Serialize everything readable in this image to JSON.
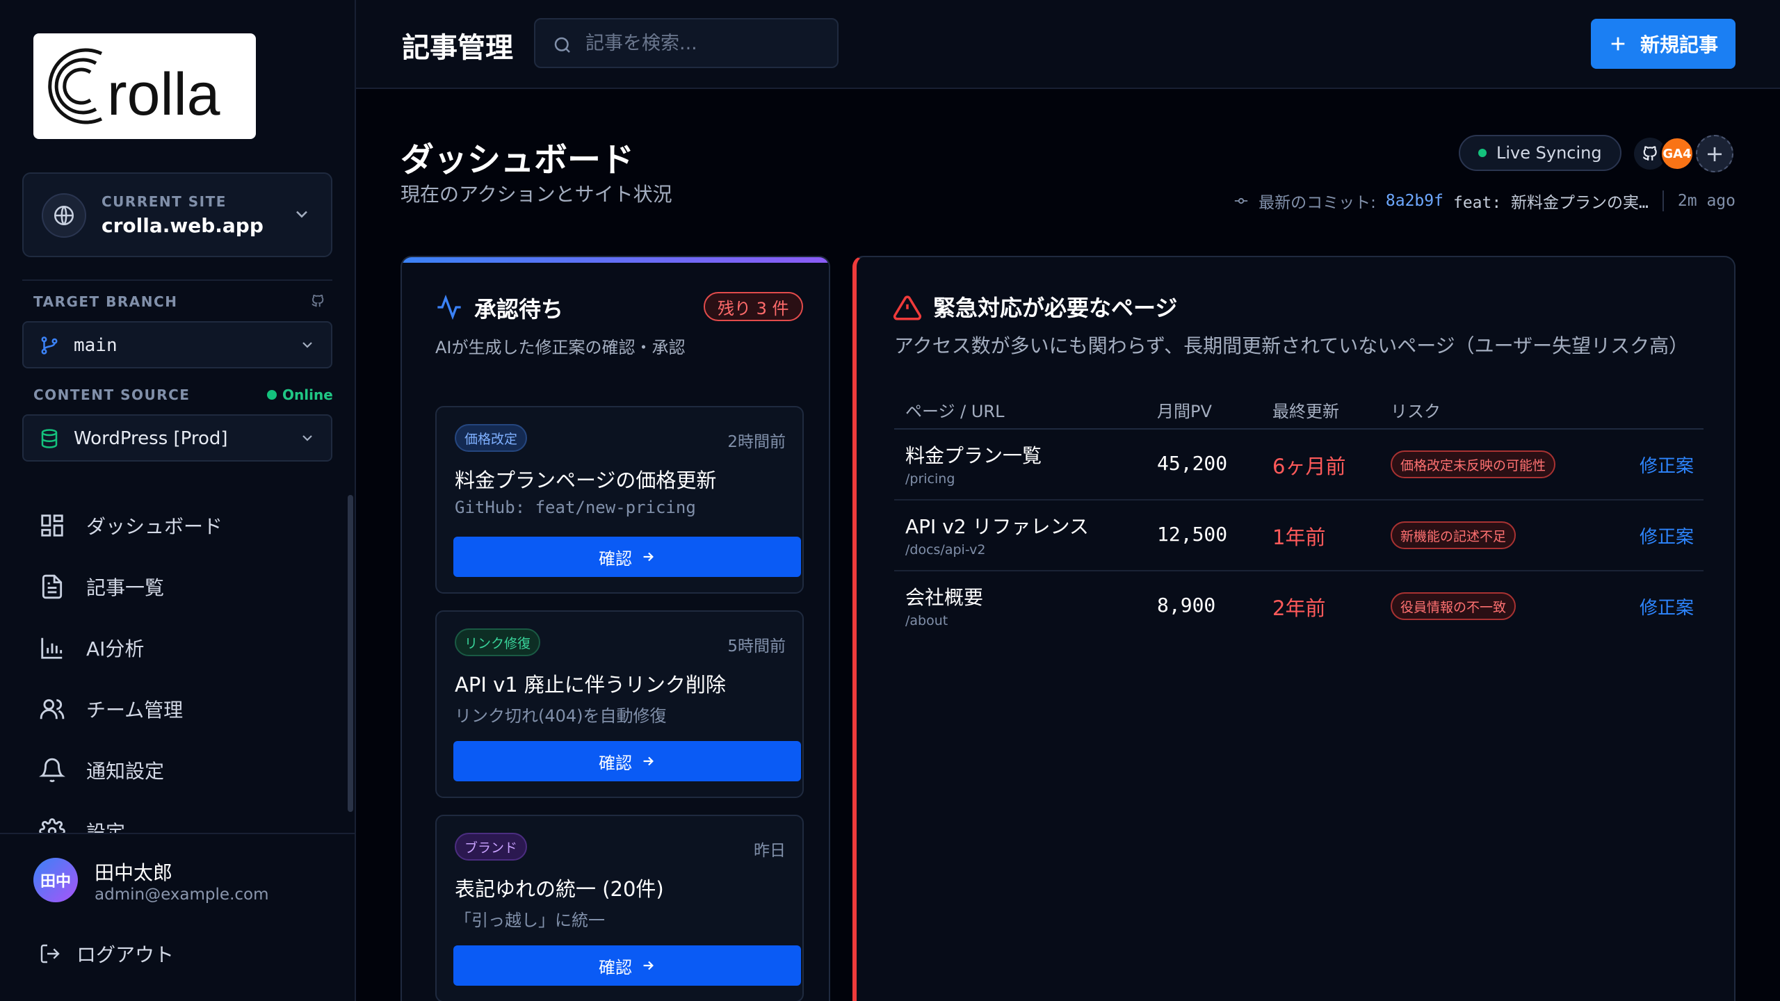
{
  "brand": {
    "logo_text": "Crolla"
  },
  "sidebar": {
    "site_caption": "CURRENT SITE",
    "site_name": "crolla.web.app",
    "branch_caption": "TARGET BRANCH",
    "branch": "main",
    "source_caption": "CONTENT SOURCE",
    "source_status": "Online",
    "source": "WordPress [Prod]",
    "nav": [
      {
        "label": "ダッシュボード",
        "icon": "grid-icon"
      },
      {
        "label": "記事一覧",
        "icon": "document-icon"
      },
      {
        "label": "AI分析",
        "icon": "bar-chart-icon"
      },
      {
        "label": "チーム管理",
        "icon": "users-icon"
      },
      {
        "label": "通知設定",
        "icon": "bell-icon"
      },
      {
        "label": "設定",
        "icon": "gear-icon"
      }
    ],
    "user": {
      "initials": "田中",
      "name": "田中太郎",
      "email": "admin@example.com"
    },
    "logout": "ログアウト"
  },
  "header": {
    "title": "記事管理",
    "search_placeholder": "記事を検索...",
    "new_button": "新規記事"
  },
  "dashboard": {
    "title": "ダッシュボード",
    "subtitle": "現在のアクションとサイト状況",
    "live_status": "Live Syncing",
    "integrations": [
      "GA4"
    ],
    "commit_label": "最新のコミット:",
    "commit_hash": "8a2b9f",
    "commit_message": "feat: 新料金プランの実…",
    "commit_time": "2m ago"
  },
  "pending": {
    "title": "承認待ち",
    "badge": "残り 3 件",
    "subtitle": "AIが生成した修正案の確認・承認",
    "confirm_label": "確認",
    "tasks": [
      {
        "tag": "価格改定",
        "time": "2時間前",
        "title": "料金プランページの価格更新",
        "desc": "GitHub: feat/new-pricing"
      },
      {
        "tag": "リンク修復",
        "time": "5時間前",
        "title": "API v1 廃止に伴うリンク削除",
        "desc": "リンク切れ(404)を自動修復"
      },
      {
        "tag": "ブランド",
        "time": "昨日",
        "title": "表記ゆれの統一 (20件)",
        "desc": "「引っ越し」に統一"
      }
    ]
  },
  "urgent": {
    "title": "緊急対応が必要なページ",
    "subtitle": "アクセス数が多いにも関わらず、長期間更新されていないページ（ユーザー失望リスク高）",
    "columns": [
      "ページ / URL",
      "月間PV",
      "最終更新",
      "リスク"
    ],
    "link_label": "修正案",
    "rows": [
      {
        "page": "料金プラン一覧",
        "url": "/pricing",
        "pv": "45,200",
        "updated": "6ヶ月前",
        "risk": "価格改定未反映の可能性"
      },
      {
        "page": "API v2 リファレンス",
        "url": "/docs/api-v2",
        "pv": "12,500",
        "updated": "1年前",
        "risk": "新機能の記述不足"
      },
      {
        "page": "会社概要",
        "url": "/about",
        "pv": "8,900",
        "updated": "2年前",
        "risk": "役員情報の不一致"
      }
    ]
  },
  "colors": {
    "accent": "#1b7ff3",
    "confirm": "#0a5bf5",
    "danger": "#ef3b3b",
    "online": "#14c27d",
    "ga4": "#f97316"
  }
}
